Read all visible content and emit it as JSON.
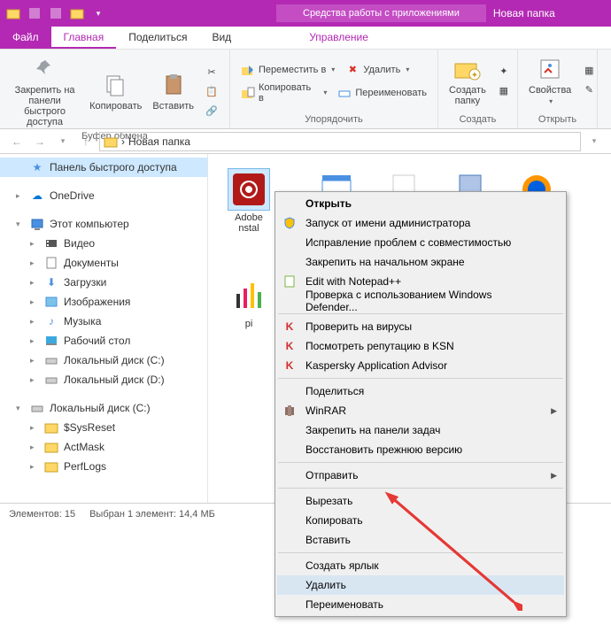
{
  "titlebar": {
    "tools_label": "Средства работы с приложениями",
    "title": "Новая папка"
  },
  "tabs": {
    "file": "Файл",
    "home": "Главная",
    "share": "Поделиться",
    "view": "Вид",
    "manage": "Управление"
  },
  "ribbon": {
    "pin": "Закрепить на панели\nбыстрого доступа",
    "copy": "Копировать",
    "paste": "Вставить",
    "clipboard_group": "Буфер обмена",
    "move_to": "Переместить в",
    "copy_to": "Копировать в",
    "delete": "Удалить",
    "rename": "Переименовать",
    "organize_group": "Упорядочить",
    "new_folder": "Создать\nпапку",
    "create_group": "Создать",
    "properties": "Свойства",
    "open_group": "Открыть"
  },
  "path": {
    "arrow": "›",
    "current": "Новая папка"
  },
  "tree": {
    "quick_access": "Панель быстрого доступа",
    "onedrive": "OneDrive",
    "this_pc": "Этот компьютер",
    "videos": "Видео",
    "documents": "Документы",
    "downloads": "Загрузки",
    "pictures": "Изображения",
    "music": "Музыка",
    "desktop": "Рабочий стол",
    "disk_c": "Локальный диск (C:)",
    "disk_d": "Локальный диск (D:)",
    "disk_c2": "Локальный диск (C:)",
    "sysreset": "$SysReset",
    "actmask": "ActMask",
    "perflogs": "PerfLogs"
  },
  "files": {
    "adobe": "Adobe\nnstal"
  },
  "status": {
    "count_label": "Элементов:",
    "count": "15",
    "selected_label": "Выбран 1 элемент:",
    "size": "14,4 МБ"
  },
  "menu": {
    "open": "Открыть",
    "run_admin": "Запуск от имени администратора",
    "troubleshoot": "Исправление проблем с совместимостью",
    "pin_start": "Закрепить на начальном экране",
    "edit_npp": "Edit with Notepad++",
    "defender": "Проверка с использованием Windows Defender...",
    "virus_check": "Проверить на вирусы",
    "ksn": "Посмотреть репутацию в KSN",
    "kaspersky": "Kaspersky Application Advisor",
    "share": "Поделиться",
    "winrar": "WinRAR",
    "pin_taskbar": "Закрепить на панели задач",
    "restore": "Восстановить прежнюю версию",
    "send_to": "Отправить",
    "cut": "Вырезать",
    "copy": "Копировать",
    "paste": "Вставить",
    "shortcut": "Создать ярлык",
    "delete": "Удалить",
    "rename": "Переименовать"
  }
}
